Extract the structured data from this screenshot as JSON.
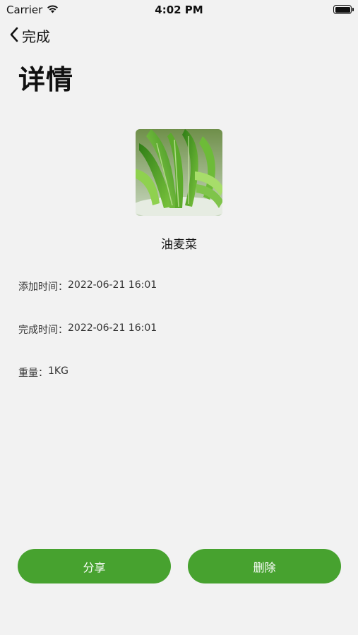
{
  "status_bar": {
    "carrier": "Carrier",
    "time": "4:02 PM"
  },
  "nav": {
    "back_label": "完成",
    "title": "详情"
  },
  "product": {
    "name": "油麦菜",
    "image_icon": "lettuce-image"
  },
  "details": {
    "added_label": "添加时间：",
    "added_value": "2022-06-21 16:01",
    "completed_label": "完成时间：",
    "completed_value": "2022-06-21 16:01",
    "weight_label": "重量：",
    "weight_value": "1KG"
  },
  "actions": {
    "share_label": "分享",
    "delete_label": "删除"
  },
  "colors": {
    "accent": "#47a22f",
    "background": "#f2f2f2"
  }
}
